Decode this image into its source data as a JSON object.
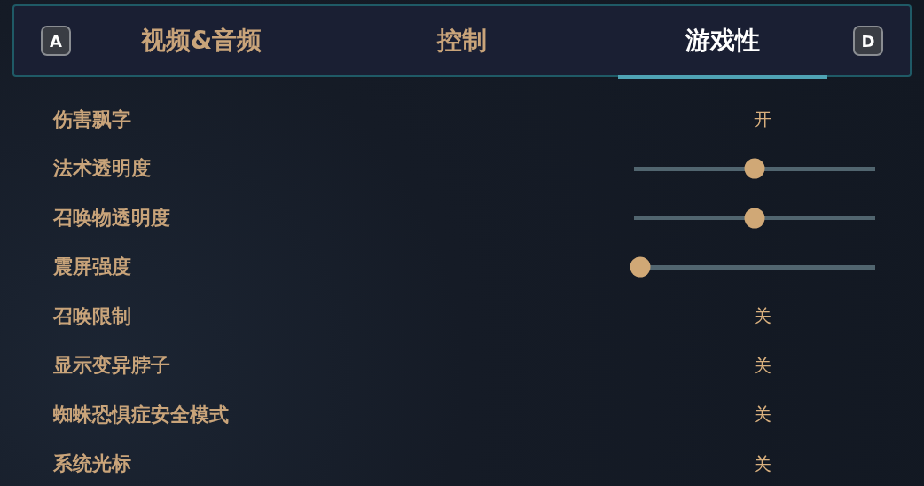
{
  "keys": {
    "left": "A",
    "right": "D"
  },
  "tabs": [
    {
      "label": "视频&音频",
      "selected": false
    },
    {
      "label": "控制",
      "selected": false
    },
    {
      "label": "游戏性",
      "selected": true
    }
  ],
  "settings": [
    {
      "kind": "toggle",
      "label": "伤害飘字",
      "value": "开"
    },
    {
      "kind": "slider",
      "label": "法术透明度",
      "level": 0.5
    },
    {
      "kind": "slider",
      "label": "召唤物透明度",
      "level": 0.5
    },
    {
      "kind": "slider",
      "label": "震屏强度",
      "level": 0
    },
    {
      "kind": "toggle",
      "label": "召唤限制",
      "value": "关"
    },
    {
      "kind": "toggle",
      "label": "显示变异脖子",
      "value": "关"
    },
    {
      "kind": "toggle",
      "label": "蜘蛛恐惧症安全模式",
      "value": "关"
    },
    {
      "kind": "toggle",
      "label": "系统光标",
      "value": "关"
    }
  ]
}
